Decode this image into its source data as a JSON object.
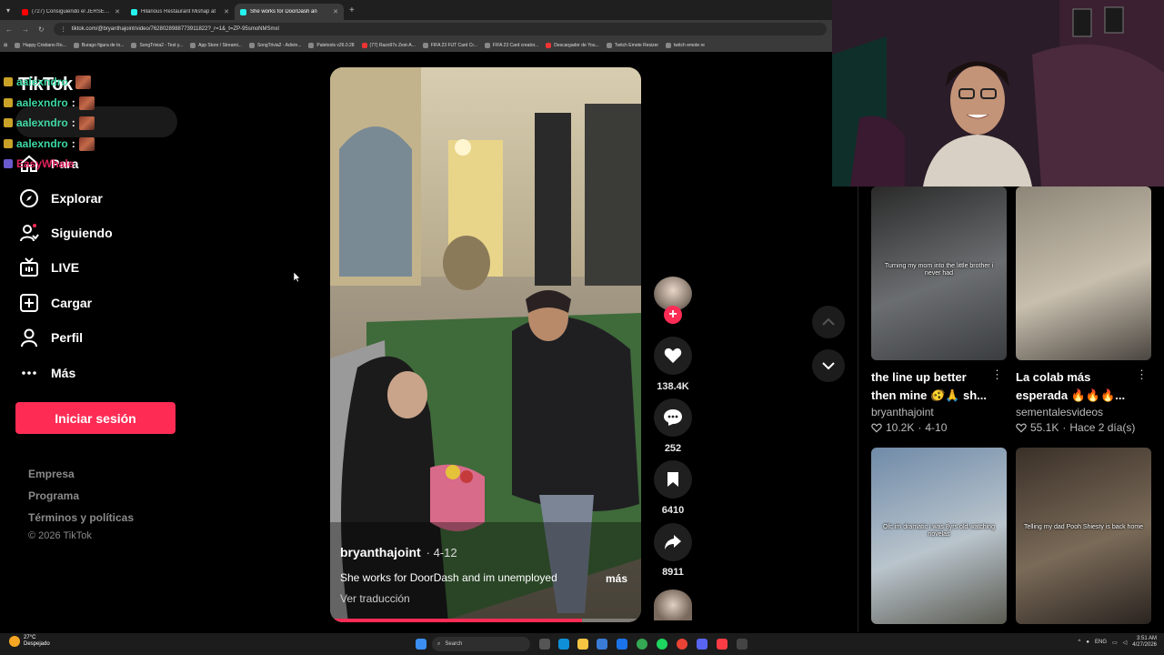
{
  "browser": {
    "tabs": [
      {
        "title": "(727) Consiguiendo el JERSEY d",
        "color": "#ff0000",
        "active": false
      },
      {
        "title": "Hilarious Restaurant Mishap at",
        "color": "#25f4ee",
        "active": false
      },
      {
        "title": "She works for DoorDash an",
        "color": "#25f4ee",
        "active": true
      }
    ],
    "url": "tiktok.com/@bryanthajoint/video/7628028988773911822?_r=1&_t=ZP-95smoNMSmxl",
    "bookmarks": [
      "Happy Cristiano Ro...",
      "Burago figura de to...",
      "SongTrivia2 - Test y...",
      "App Store / Streami...",
      "SongTrivia2 - Adivin...",
      "Paletools v26.0.28",
      "(77) Razo97s Zest-A...",
      "FIFA 23 FUT Card Cr...",
      "FIFA 23 Card creator...",
      "Descargador de You...",
      "Twitch Emote Resizer",
      "twitch emote re"
    ]
  },
  "sidebar": {
    "logo": "TikTok",
    "items": [
      {
        "label": "Para",
        "icon": "home-icon"
      },
      {
        "label": "Explorar",
        "icon": "compass-icon"
      },
      {
        "label": "Siguiendo",
        "icon": "following-icon"
      },
      {
        "label": "LIVE",
        "icon": "live-tv-icon"
      },
      {
        "label": "Cargar",
        "icon": "upload-icon"
      },
      {
        "label": "Perfil",
        "icon": "profile-icon"
      },
      {
        "label": "Más",
        "icon": "more-icon"
      }
    ],
    "login_label": "Iniciar sesión",
    "footer_links": [
      "Empresa",
      "Programa",
      "Términos y políticas"
    ],
    "copyright": "© 2026 TikTok"
  },
  "chat": [
    {
      "user": "aalexndro",
      "sep": ""
    },
    {
      "user": "aalexndro",
      "sep": ":"
    },
    {
      "user": "aalexndro",
      "sep": ":"
    },
    {
      "user": "aalexndro",
      "sep": ":"
    },
    {
      "user": "EasyWhale",
      "sep": ""
    }
  ],
  "video": {
    "username": "bryanthajoint",
    "date": "4-12",
    "caption": "She works for DoorDash and im unemployed",
    "more_label": "más",
    "translate_label": "Ver traducción",
    "progress": 0.81
  },
  "actions": {
    "likes": "138.4K",
    "comments": "252",
    "saves": "6410",
    "shares": "8911"
  },
  "related": [
    {
      "title": "the line up better then mine 🫨🙏 sh...",
      "user": "bryanthajoint",
      "views": "10.2K",
      "date": "4-10",
      "overlay": "Turning my mom into the little brother i never had",
      "colors": [
        "#2a2a2a",
        "#6b6e70",
        "#3a3d40"
      ]
    },
    {
      "title": "La colab más esperada 🔥🔥🔥...",
      "user": "sementalesvideos",
      "views": "55.1K",
      "date": "Hace 2 día(s)",
      "overlay": "",
      "colors": [
        "#8d8577",
        "#c8bfae",
        "#4a4540"
      ]
    },
    {
      "title": "",
      "user": "",
      "views": "",
      "date": "",
      "overlay": "Ofc im dramatic i was 8yrs old watching novelas",
      "colors": [
        "#6f8aa8",
        "#b9c4cc",
        "#5a5a50"
      ]
    },
    {
      "title": "",
      "user": "",
      "views": "",
      "date": "",
      "overlay": "Telling my dad Pooh Shiesty is back home",
      "colors": [
        "#3a3028",
        "#7a6a58",
        "#2a2420"
      ]
    }
  ],
  "taskbar": {
    "temperature": "27°C",
    "weather": "Despejado",
    "search_placeholder": "Search",
    "language": "ENG",
    "time": "3:51 AM",
    "date": "4/27/2026"
  }
}
